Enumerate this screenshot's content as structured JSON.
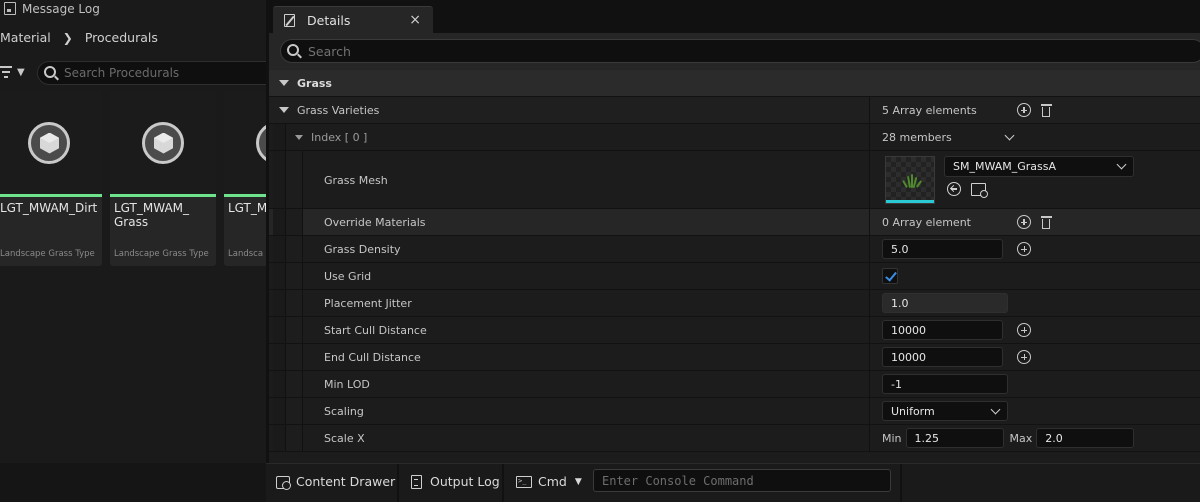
{
  "left_panel": {
    "message_log": "Message Log",
    "breadcrumb": [
      "Material",
      "Procedurals"
    ],
    "search_placeholder": "Search Procedurals",
    "assets": [
      {
        "name": "LGT_MWAM_Dirt",
        "type": "Landscape Grass Type"
      },
      {
        "name": "LGT_MWAM_\nGrass",
        "type": "Landscape Grass Type"
      },
      {
        "name": "LGT_M",
        "type": "Landsca"
      }
    ]
  },
  "details": {
    "tab_label": "Details",
    "tab_close": "×",
    "search_placeholder": "Search",
    "section": "Grass",
    "varieties_label": "Grass Varieties",
    "varieties_value": "5 Array elements",
    "index_label": "Index [ 0 ]",
    "index_value": "28 members",
    "grass_mesh_label": "Grass Mesh",
    "grass_mesh_value": "SM_MWAM_GrassA",
    "override_label": "Override Materials",
    "override_value": "0 Array element",
    "density_label": "Grass Density",
    "density_value": "5.0",
    "use_grid_label": "Use Grid",
    "use_grid_checked": true,
    "jitter_label": "Placement Jitter",
    "jitter_value": "1.0",
    "start_cull_label": "Start Cull Distance",
    "start_cull_value": "10000",
    "end_cull_label": "End Cull Distance",
    "end_cull_value": "10000",
    "min_lod_label": "Min LOD",
    "min_lod_value": "-1",
    "scaling_label": "Scaling",
    "scaling_value": "Uniform",
    "scale_x_label": "Scale X",
    "scale_x_min_label": "Min",
    "scale_x_min": "1.25",
    "scale_x_max_label": "Max",
    "scale_x_max": "2.0"
  },
  "statusbar": {
    "content_drawer": "Content Drawer",
    "output_log": "Output Log",
    "cmd": "Cmd",
    "console_placeholder": "Enter Console Command"
  },
  "colors": {
    "accent_green": "#6fe28d",
    "check_blue": "#3a8ee6",
    "thumb_cyan": "#2bc9d4"
  }
}
